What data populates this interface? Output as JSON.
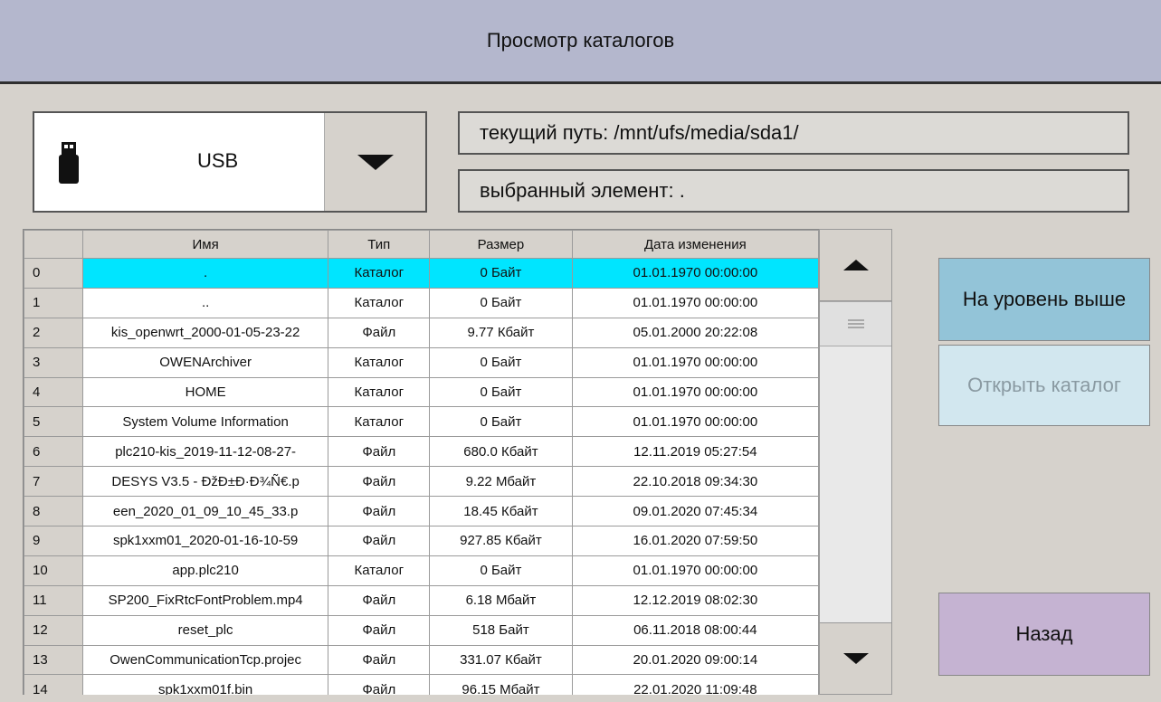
{
  "title": "Просмотр каталогов",
  "drive": {
    "label": "USB",
    "icon": "usb-drive-icon"
  },
  "current_path": {
    "label": "текущий путь:",
    "value": "/mnt/ufs/media/sda1/"
  },
  "selected_item": {
    "label": "выбранный элемент:",
    "value": "."
  },
  "table": {
    "columns": [
      "Имя",
      "Тип",
      "Размер",
      "Дата изменения"
    ],
    "selected_index": 0,
    "rows": [
      {
        "idx": "0",
        "name": ".",
        "type": "Каталог",
        "size": "0 Байт",
        "date": "01.01.1970 00:00:00"
      },
      {
        "idx": "1",
        "name": "..",
        "type": "Каталог",
        "size": "0 Байт",
        "date": "01.01.1970 00:00:00"
      },
      {
        "idx": "2",
        "name": "kis_openwrt_2000-01-05-23-22",
        "type": "Файл",
        "size": "9.77 Кбайт",
        "date": "05.01.2000 20:22:08"
      },
      {
        "idx": "3",
        "name": "OWENArchiver",
        "type": "Каталог",
        "size": "0 Байт",
        "date": "01.01.1970 00:00:00"
      },
      {
        "idx": "4",
        "name": "HOME",
        "type": "Каталог",
        "size": "0 Байт",
        "date": "01.01.1970 00:00:00"
      },
      {
        "idx": "5",
        "name": "System Volume Information",
        "type": "Каталог",
        "size": "0 Байт",
        "date": "01.01.1970 00:00:00"
      },
      {
        "idx": "6",
        "name": "plc210-kis_2019-11-12-08-27-",
        "type": "Файл",
        "size": "680.0 Кбайт",
        "date": "12.11.2019 05:27:54"
      },
      {
        "idx": "7",
        "name": "DESYS V3.5 - ĐžĐ±Đ·Đ¾Ñ€.p",
        "type": "Файл",
        "size": "9.22 Мбайт",
        "date": "22.10.2018 09:34:30"
      },
      {
        "idx": "8",
        "name": "een_2020_01_09_10_45_33.p",
        "type": "Файл",
        "size": "18.45 Кбайт",
        "date": "09.01.2020 07:45:34"
      },
      {
        "idx": "9",
        "name": "spk1xxm01_2020-01-16-10-59",
        "type": "Файл",
        "size": "927.85 Кбайт",
        "date": "16.01.2020 07:59:50"
      },
      {
        "idx": "10",
        "name": "app.plc210",
        "type": "Каталог",
        "size": "0 Байт",
        "date": "01.01.1970 00:00:00"
      },
      {
        "idx": "11",
        "name": "SP200_FixRtcFontProblem.mp4",
        "type": "Файл",
        "size": "6.18 Мбайт",
        "date": "12.12.2019 08:02:30"
      },
      {
        "idx": "12",
        "name": "reset_plc",
        "type": "Файл",
        "size": "518 Байт",
        "date": "06.11.2018 08:00:44"
      },
      {
        "idx": "13",
        "name": "OwenCommunicationTcp.projec",
        "type": "Файл",
        "size": "331.07 Кбайт",
        "date": "20.01.2020 09:00:14"
      },
      {
        "idx": "14",
        "name": "spk1xxm01f.bin",
        "type": "Файл",
        "size": "96.15 Мбайт",
        "date": "22.01.2020 11:09:48"
      }
    ]
  },
  "buttons": {
    "up_level": "На уровень выше",
    "open_dir": "Открыть каталог",
    "back": "Назад"
  },
  "colors": {
    "selection": "#00e5ff",
    "up_button": "#93c4d8",
    "open_button_disabled": "#d2e7ef",
    "back_button": "#c5b3d2",
    "title_bar": "#b4b7cd"
  }
}
